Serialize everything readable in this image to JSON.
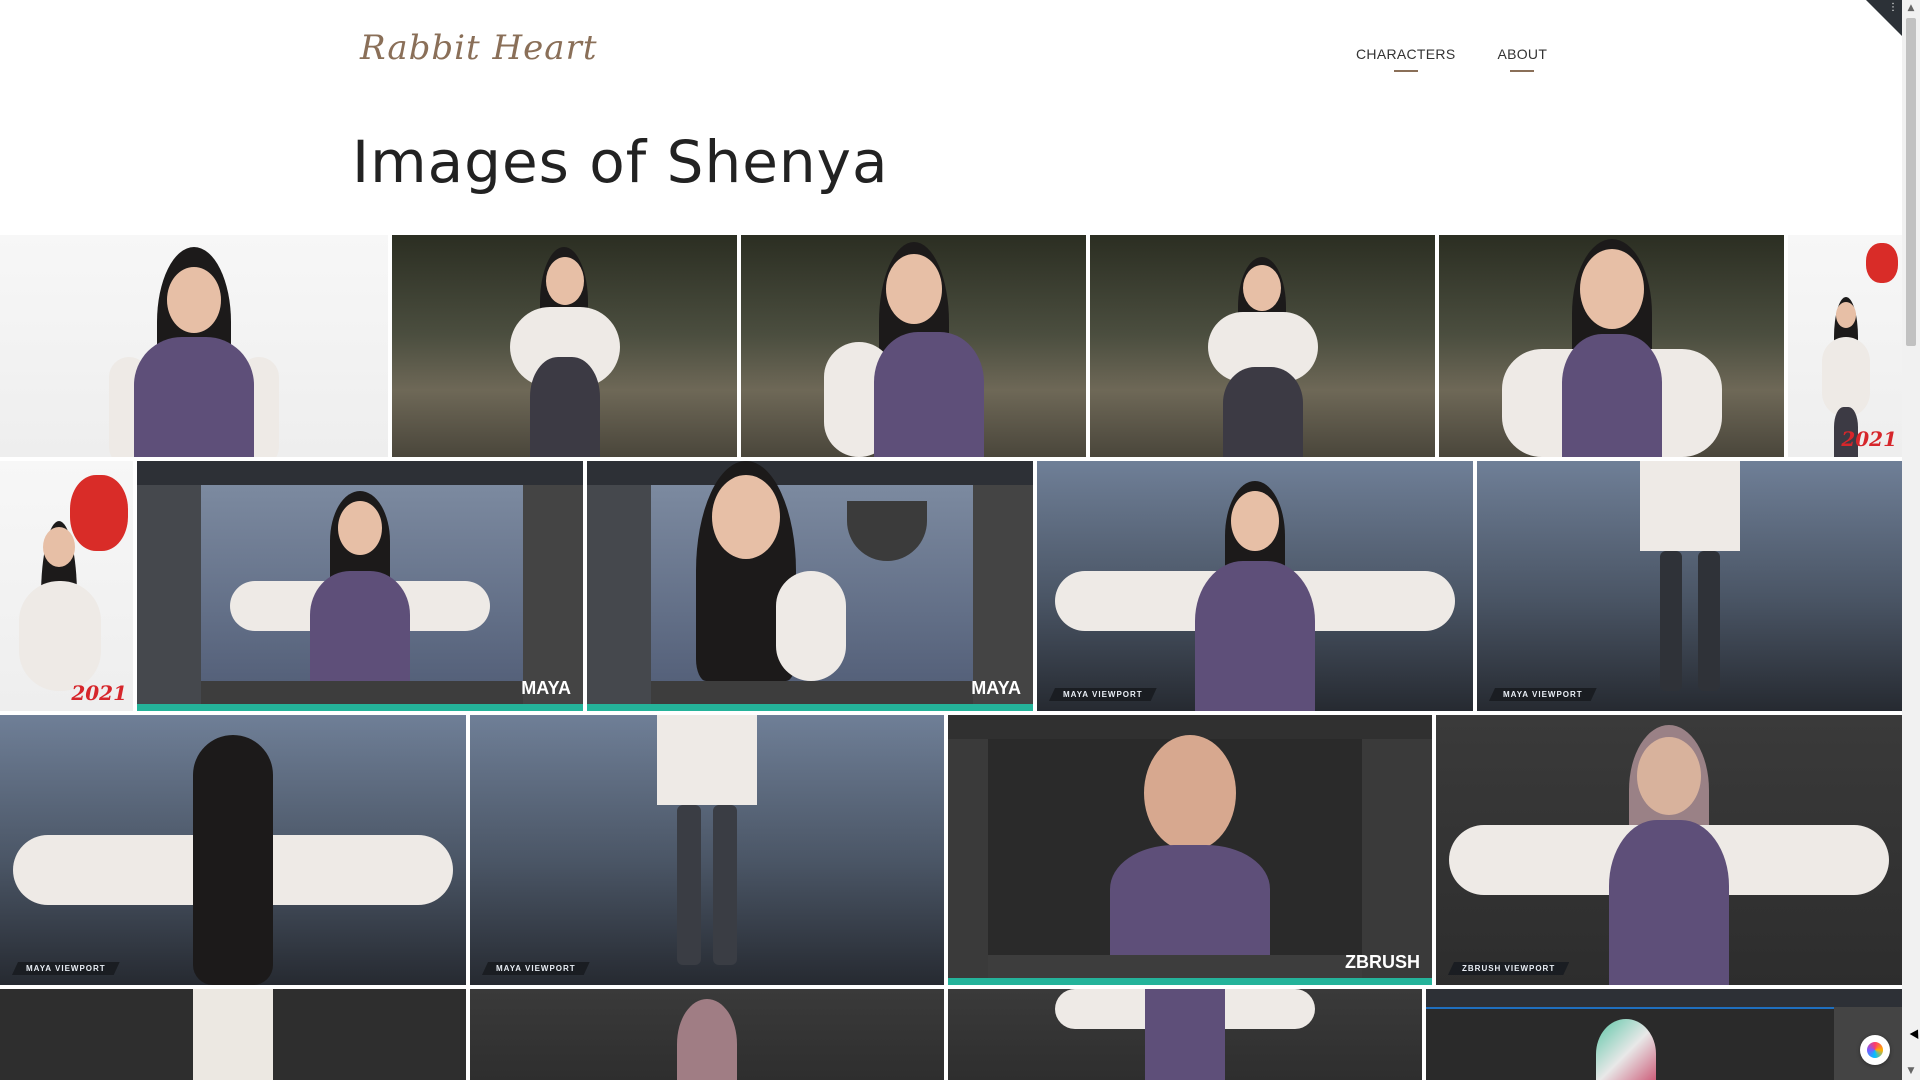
{
  "header": {
    "logo_text": "Rabbit Heart",
    "nav": [
      {
        "label": "CHARACTERS"
      },
      {
        "label": "ABOUT"
      }
    ]
  },
  "page_title": "Images of Shenya",
  "gallery": {
    "row1": [
      {
        "scene": "white-bust"
      },
      {
        "scene": "forest-sitting"
      },
      {
        "scene": "forest-closeup"
      },
      {
        "scene": "forest-steps"
      },
      {
        "scene": "forest-portrait"
      },
      {
        "scene": "lantern",
        "year": "2021"
      }
    ],
    "row2": [
      {
        "scene": "lantern",
        "year": "2021"
      },
      {
        "scene": "maya-app",
        "brand": "MAYA"
      },
      {
        "scene": "maya-app",
        "brand": "MAYA"
      },
      {
        "scene": "viewport",
        "label": "MAYA VIEWPORT"
      },
      {
        "scene": "viewport-legs",
        "label": "MAYA VIEWPORT"
      }
    ],
    "row3": [
      {
        "scene": "viewport-back",
        "label": "MAYA VIEWPORT"
      },
      {
        "scene": "viewport-legs",
        "label": "MAYA VIEWPORT"
      },
      {
        "scene": "zbrush-app",
        "brand": "ZBRUSH"
      },
      {
        "scene": "zbrush-viewport",
        "label": "ZBRUSH VIEWPORT"
      }
    ]
  },
  "colors": {
    "accent": "#8a6f58",
    "maya_bar": "#24b39a",
    "year_red": "#d6262b"
  }
}
